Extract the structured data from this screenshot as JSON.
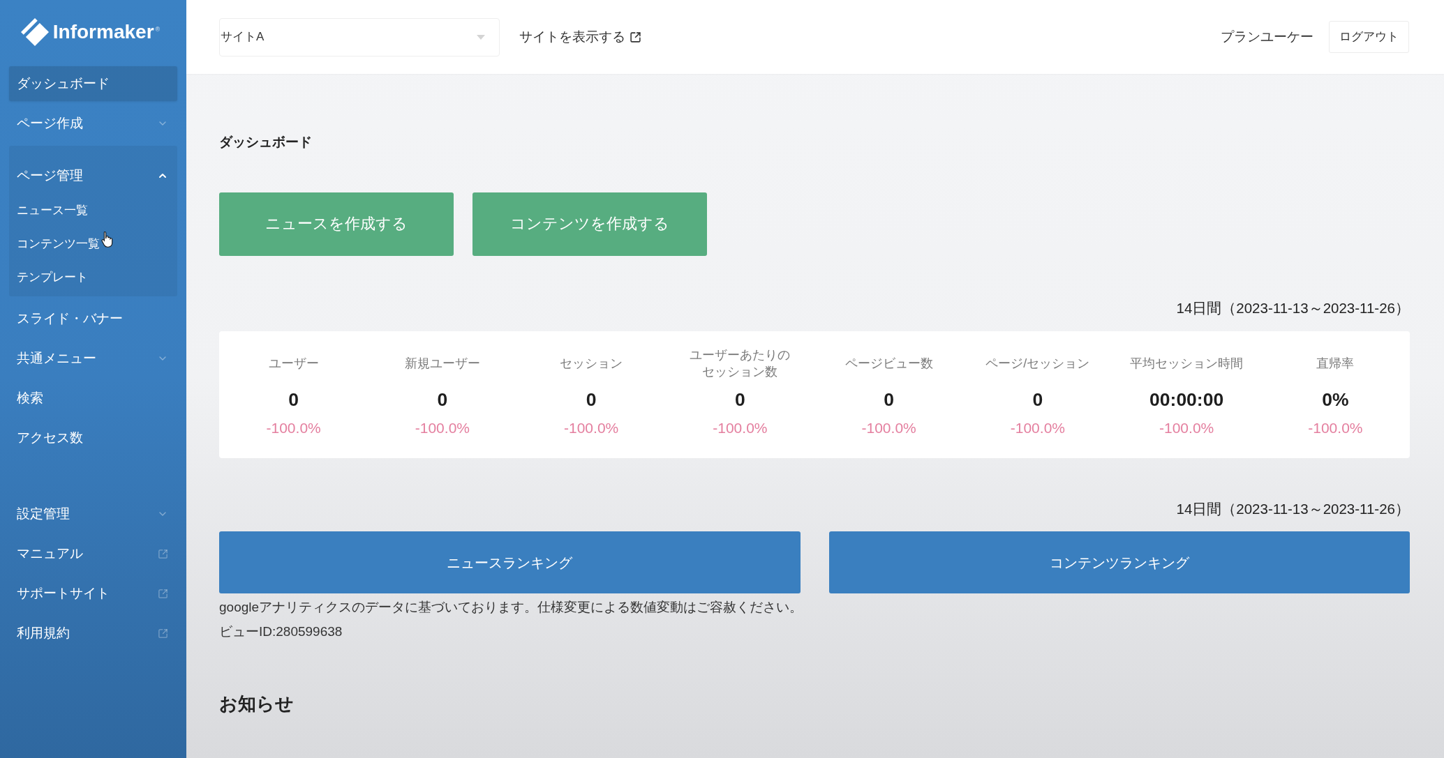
{
  "sidebar": {
    "logo": {
      "text": "Informaker",
      "mark": "®"
    },
    "sections": [
      {
        "items": [
          {
            "kind": "link",
            "label": "ダッシュボード",
            "selected": true
          },
          {
            "kind": "group",
            "label": "ページ作成",
            "expanded": false,
            "selected": false
          },
          {
            "kind": "group",
            "label": "ページ管理",
            "expanded": true,
            "selected": false,
            "children": [
              {
                "label": "ニュース一覧",
                "selected": false
              },
              {
                "label": "コンテンツ一覧",
                "selected": false
              },
              {
                "label": "テンプレート",
                "selected": false
              }
            ]
          },
          {
            "kind": "link",
            "label": "スライド・バナー",
            "selected": false
          },
          {
            "kind": "group",
            "label": "共通メニュー",
            "expanded": false,
            "selected": false
          },
          {
            "kind": "link",
            "label": "検索",
            "selected": false
          },
          {
            "kind": "link",
            "label": "アクセス数",
            "selected": false
          }
        ]
      },
      {
        "items": [
          {
            "kind": "group",
            "label": "設定管理",
            "expanded": false,
            "selected": false
          },
          {
            "kind": "external",
            "label": "マニュアル",
            "selected": false
          },
          {
            "kind": "external",
            "label": "サポートサイト",
            "selected": false
          },
          {
            "kind": "external",
            "label": "利用規約",
            "selected": false
          }
        ]
      }
    ]
  },
  "top_bar": {
    "site_select": {
      "value": "サイトA"
    },
    "view_site_link": "サイトを表示する",
    "user_name": "プランユーケー",
    "logout_button": "ログアウト"
  },
  "dashboard": {
    "title": "ダッシュボード",
    "create_buttons": [
      "ニュースを作成する",
      "コンテンツを作成する"
    ],
    "stats_period": "14日間（2023-11-13～2023-11-26）",
    "stats": [
      {
        "label": "ユーザー",
        "value": "0",
        "change": "-100.0%"
      },
      {
        "label": "新規ユーザー",
        "value": "0",
        "change": "-100.0%"
      },
      {
        "label": "セッション",
        "value": "0",
        "change": "-100.0%"
      },
      {
        "label": "ユーザーあたりのセッション数",
        "value": "0",
        "change": "-100.0%"
      },
      {
        "label": "ページビュー数",
        "value": "0",
        "change": "-100.0%"
      },
      {
        "label": "ページ/セッション",
        "value": "0",
        "change": "-100.0%"
      },
      {
        "label": "平均セッション時間",
        "value": "00:00:00",
        "change": "-100.0%"
      },
      {
        "label": "直帰率",
        "value": "0%",
        "change": "-100.0%"
      }
    ],
    "ranking_period": "14日間（2023-11-13～2023-11-26）",
    "ranking_buttons": [
      "ニュースランキング",
      "コンテンツランキング"
    ],
    "notes": [
      "googleアナリティクスのデータに基づいております。仕様変更による数値変動はご容赦ください。",
      "ビューID:280599638"
    ],
    "news_heading": "お知らせ"
  }
}
